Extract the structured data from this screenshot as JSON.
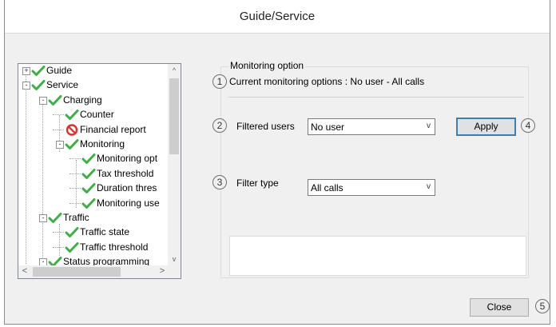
{
  "window": {
    "title": "Guide/Service"
  },
  "tree": {
    "nodes": [
      {
        "label": "Guide",
        "expander": "+",
        "icon": "check-icon"
      },
      {
        "label": "Service",
        "expander": "-",
        "icon": "check-icon"
      },
      {
        "label": "Charging",
        "expander": "-",
        "icon": "check-icon"
      },
      {
        "label": "Counter",
        "expander": "",
        "icon": "check-icon"
      },
      {
        "label": "Financial report",
        "expander": "",
        "icon": "forbidden-icon"
      },
      {
        "label": "Monitoring",
        "expander": "-",
        "icon": "check-icon"
      },
      {
        "label": "Monitoring opt",
        "expander": "",
        "icon": "check-icon"
      },
      {
        "label": "Tax threshold",
        "expander": "",
        "icon": "check-icon"
      },
      {
        "label": "Duration thres",
        "expander": "",
        "icon": "check-icon"
      },
      {
        "label": "Monitoring use",
        "expander": "",
        "icon": "check-icon"
      },
      {
        "label": "Traffic",
        "expander": "-",
        "icon": "check-icon"
      },
      {
        "label": "Traffic state",
        "expander": "",
        "icon": "check-icon"
      },
      {
        "label": "Traffic threshold",
        "expander": "",
        "icon": "check-icon"
      },
      {
        "label": "Status programming",
        "expander": "-",
        "icon": "check-icon"
      }
    ],
    "scroll_up": "^",
    "scroll_down": "v",
    "scroll_left": "<",
    "scroll_right": ">"
  },
  "panel": {
    "group_title": "Monitoring option",
    "current_text": "Current monitoring options : No user - All calls",
    "filtered_users_label": "Filtered users",
    "filtered_users_value": "No user",
    "filter_type_label": "Filter type",
    "filter_type_value": "All calls",
    "apply_label": "Apply",
    "dropdown_arrow": "v"
  },
  "footer": {
    "close_label": "Close"
  },
  "callouts": [
    "1",
    "2",
    "3",
    "4",
    "5"
  ],
  "colors": {
    "check": "#3cb043",
    "forbidden": "#e0302b",
    "default_button_border": "#3c7fb1"
  }
}
